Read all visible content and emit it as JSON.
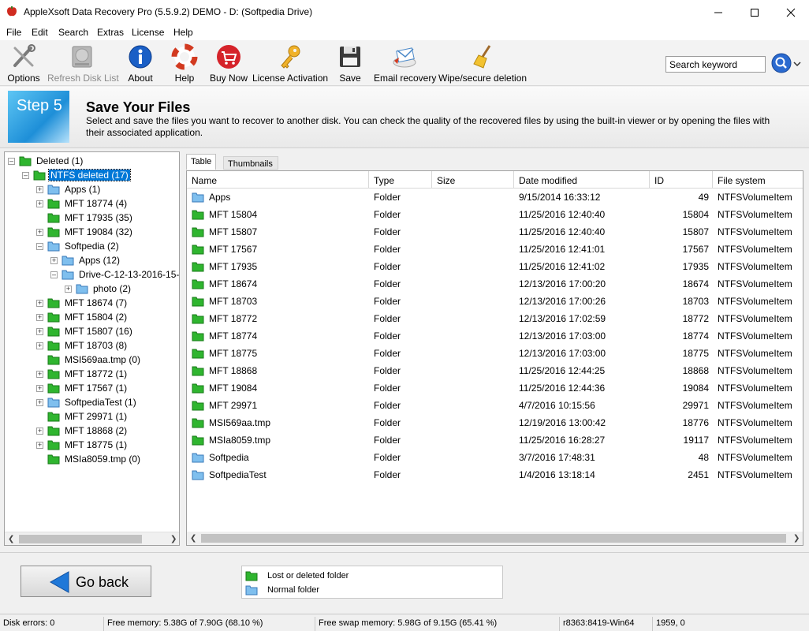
{
  "window": {
    "title": "AppleXsoft Data Recovery Pro (5.5.9.2) DEMO - D: (Softpedia Drive)"
  },
  "menu": [
    "File",
    "Edit",
    "Search",
    "Extras",
    "License",
    "Help"
  ],
  "toolbar": {
    "options": "Options",
    "refresh": "Refresh Disk List",
    "about": "About",
    "help": "Help",
    "buy": "Buy Now",
    "license": "License Activation",
    "save": "Save",
    "email": "Email recovery",
    "wipe": "Wipe/secure deletion"
  },
  "search": {
    "placeholder": "Search keyword",
    "value": "Search keyword"
  },
  "step": {
    "label": "Step 5",
    "title": "Save Your Files",
    "description": "Select and save the files you want to recover to another disk. You can check the quality of the recovered files by using the built-in viewer or by opening the files with their associated application."
  },
  "tree": [
    {
      "label": "Deleted (1)",
      "depth": 0,
      "toggle": "-",
      "icon": "green"
    },
    {
      "label": "NTFS deleted (17)",
      "depth": 1,
      "toggle": "-",
      "icon": "green",
      "selected": true
    },
    {
      "label": "Apps (1)",
      "depth": 2,
      "toggle": "+",
      "icon": "blue"
    },
    {
      "label": "MFT 18774 (4)",
      "depth": 2,
      "toggle": "+",
      "icon": "green"
    },
    {
      "label": "MFT 17935 (35)",
      "depth": 2,
      "toggle": "",
      "icon": "green"
    },
    {
      "label": "MFT 19084 (32)",
      "depth": 2,
      "toggle": "+",
      "icon": "green"
    },
    {
      "label": "Softpedia (2)",
      "depth": 2,
      "toggle": "-",
      "icon": "blue"
    },
    {
      "label": "Apps (12)",
      "depth": 3,
      "toggle": "+",
      "icon": "blue"
    },
    {
      "label": "Drive-C-12-13-2016-15-",
      "depth": 3,
      "toggle": "-",
      "icon": "blue"
    },
    {
      "label": "photo (2)",
      "depth": 4,
      "toggle": "+",
      "icon": "blue"
    },
    {
      "label": "MFT 18674 (7)",
      "depth": 2,
      "toggle": "+",
      "icon": "green"
    },
    {
      "label": "MFT 15804 (2)",
      "depth": 2,
      "toggle": "+",
      "icon": "green"
    },
    {
      "label": "MFT 15807 (16)",
      "depth": 2,
      "toggle": "+",
      "icon": "green"
    },
    {
      "label": "MFT 18703 (8)",
      "depth": 2,
      "toggle": "+",
      "icon": "green"
    },
    {
      "label": "MSI569aa.tmp (0)",
      "depth": 2,
      "toggle": "",
      "icon": "green"
    },
    {
      "label": "MFT 18772 (1)",
      "depth": 2,
      "toggle": "+",
      "icon": "green"
    },
    {
      "label": "MFT 17567 (1)",
      "depth": 2,
      "toggle": "+",
      "icon": "green"
    },
    {
      "label": "SoftpediaTest (1)",
      "depth": 2,
      "toggle": "+",
      "icon": "blue"
    },
    {
      "label": "MFT 29971 (1)",
      "depth": 2,
      "toggle": "",
      "icon": "green"
    },
    {
      "label": "MFT 18868 (2)",
      "depth": 2,
      "toggle": "+",
      "icon": "green"
    },
    {
      "label": "MFT 18775 (1)",
      "depth": 2,
      "toggle": "+",
      "icon": "green"
    },
    {
      "label": "MSIa8059.tmp (0)",
      "depth": 2,
      "toggle": "",
      "icon": "green"
    }
  ],
  "tabs": {
    "table": "Table",
    "thumbnails": "Thumbnails"
  },
  "table": {
    "columns": [
      "Name",
      "Type",
      "Size",
      "Date modified",
      "ID",
      "File system"
    ],
    "rows": [
      {
        "name": "Apps",
        "type": "Folder",
        "size": "",
        "date": "9/15/2014 16:33:12",
        "id": "49",
        "fs": "NTFSVolumeItem",
        "icon": "blue"
      },
      {
        "name": "MFT 15804",
        "type": "Folder",
        "size": "",
        "date": "11/25/2016 12:40:40",
        "id": "15804",
        "fs": "NTFSVolumeItem",
        "icon": "green"
      },
      {
        "name": "MFT 15807",
        "type": "Folder",
        "size": "",
        "date": "11/25/2016 12:40:40",
        "id": "15807",
        "fs": "NTFSVolumeItem",
        "icon": "green"
      },
      {
        "name": "MFT 17567",
        "type": "Folder",
        "size": "",
        "date": "11/25/2016 12:41:01",
        "id": "17567",
        "fs": "NTFSVolumeItem",
        "icon": "green"
      },
      {
        "name": "MFT 17935",
        "type": "Folder",
        "size": "",
        "date": "11/25/2016 12:41:02",
        "id": "17935",
        "fs": "NTFSVolumeItem",
        "icon": "green"
      },
      {
        "name": "MFT 18674",
        "type": "Folder",
        "size": "",
        "date": "12/13/2016 17:00:20",
        "id": "18674",
        "fs": "NTFSVolumeItem",
        "icon": "green"
      },
      {
        "name": "MFT 18703",
        "type": "Folder",
        "size": "",
        "date": "12/13/2016 17:00:26",
        "id": "18703",
        "fs": "NTFSVolumeItem",
        "icon": "green"
      },
      {
        "name": "MFT 18772",
        "type": "Folder",
        "size": "",
        "date": "12/13/2016 17:02:59",
        "id": "18772",
        "fs": "NTFSVolumeItem",
        "icon": "green"
      },
      {
        "name": "MFT 18774",
        "type": "Folder",
        "size": "",
        "date": "12/13/2016 17:03:00",
        "id": "18774",
        "fs": "NTFSVolumeItem",
        "icon": "green"
      },
      {
        "name": "MFT 18775",
        "type": "Folder",
        "size": "",
        "date": "12/13/2016 17:03:00",
        "id": "18775",
        "fs": "NTFSVolumeItem",
        "icon": "green"
      },
      {
        "name": "MFT 18868",
        "type": "Folder",
        "size": "",
        "date": "11/25/2016 12:44:25",
        "id": "18868",
        "fs": "NTFSVolumeItem",
        "icon": "green"
      },
      {
        "name": "MFT 19084",
        "type": "Folder",
        "size": "",
        "date": "11/25/2016 12:44:36",
        "id": "19084",
        "fs": "NTFSVolumeItem",
        "icon": "green"
      },
      {
        "name": "MFT 29971",
        "type": "Folder",
        "size": "",
        "date": "4/7/2016 10:15:56",
        "id": "29971",
        "fs": "NTFSVolumeItem",
        "icon": "green"
      },
      {
        "name": "MSI569aa.tmp",
        "type": "Folder",
        "size": "",
        "date": "12/19/2016 13:00:42",
        "id": "18776",
        "fs": "NTFSVolumeItem",
        "icon": "green"
      },
      {
        "name": "MSIa8059.tmp",
        "type": "Folder",
        "size": "",
        "date": "11/25/2016 16:28:27",
        "id": "19117",
        "fs": "NTFSVolumeItem",
        "icon": "green"
      },
      {
        "name": "Softpedia",
        "type": "Folder",
        "size": "",
        "date": "3/7/2016 17:48:31",
        "id": "48",
        "fs": "NTFSVolumeItem",
        "icon": "blue"
      },
      {
        "name": "SoftpediaTest",
        "type": "Folder",
        "size": "",
        "date": "1/4/2016 13:18:14",
        "id": "2451",
        "fs": "NTFSVolumeItem",
        "icon": "blue"
      }
    ]
  },
  "bottom": {
    "go_back": "Go back",
    "legend_deleted": "Lost or deleted folder",
    "legend_normal": "Normal folder"
  },
  "status": {
    "disk_errors": "Disk errors: 0",
    "free_memory": "Free memory: 5.38G of 7.90G (68.10 %)",
    "free_swap": "Free swap memory: 5.98G of 9.15G (65.41 %)",
    "build": "r8363:8419-Win64",
    "coords": "1959, 0"
  },
  "colors": {
    "selected": "#0078d7",
    "folder_green": "#2fb52f",
    "folder_blue": "#7fbfee"
  }
}
